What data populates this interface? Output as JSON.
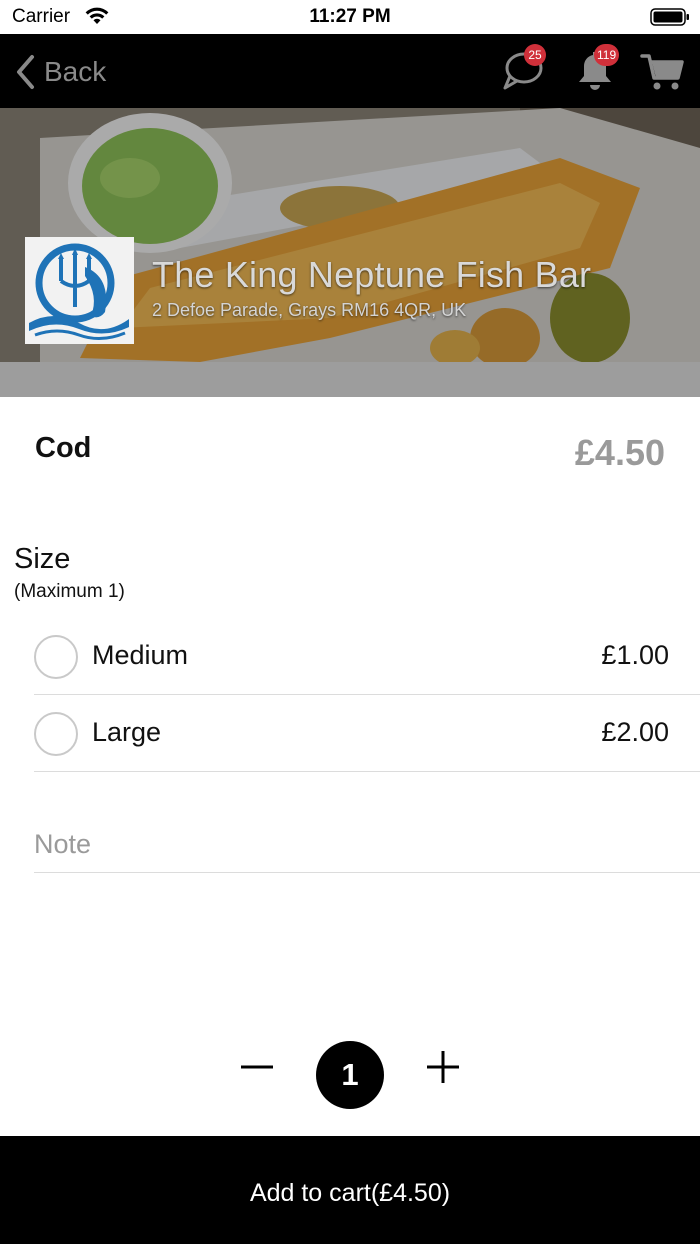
{
  "status_bar": {
    "carrier": "Carrier",
    "time": "11:27 PM"
  },
  "nav": {
    "back_label": "Back",
    "chat_badge": "25",
    "notification_badge": "119"
  },
  "restaurant": {
    "name": "The King Neptune Fish Bar",
    "address": "2 Defoe Parade, Grays RM16 4QR, UK"
  },
  "item": {
    "name": "Cod",
    "price": "£4.50"
  },
  "options": {
    "title": "Size",
    "subtitle": "(Maximum 1)",
    "choices": [
      {
        "label": "Medium",
        "price": "£1.00",
        "selected": false
      },
      {
        "label": "Large",
        "price": "£2.00",
        "selected": false
      }
    ]
  },
  "note": {
    "placeholder": "Note",
    "value": ""
  },
  "quantity": {
    "value": "1"
  },
  "cart_button": {
    "label": "Add to cart(£4.50)"
  },
  "colors": {
    "nav_background": "#000000",
    "badge": "#d0303a",
    "price_gray": "#9a9a9a",
    "cart_button_background": "#000000"
  }
}
